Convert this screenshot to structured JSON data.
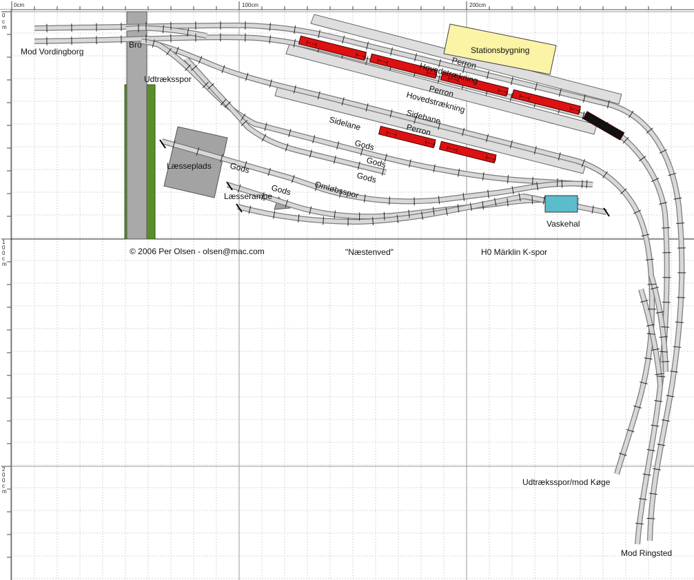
{
  "ruler": {
    "top": [
      "0cm",
      "100cm",
      "200cm"
    ],
    "left": [
      [
        "0",
        "c",
        "m"
      ],
      [
        "1",
        "0",
        "0",
        "c",
        "m"
      ],
      [
        "2",
        "0",
        "0",
        "c",
        "m"
      ]
    ]
  },
  "labels": {
    "mod_vordingborg": "Mod Vordingborg",
    "bro": "Bro",
    "udtraeksspor": "Udtræksspor",
    "laesseplads": "Læsseplads",
    "laesserampe": "Læsserampe",
    "stationsbygning": "Stationsbygning",
    "perron_1": "Perron",
    "perron_2": "Perron",
    "perron_3": "Perron",
    "hovedstraekning_1": "Hovedstrækning",
    "hovedstraekning_2": "Hovedstrækning",
    "sidebane": "Sidebane",
    "sidelane": "Sidelane",
    "gods_1": "Gods",
    "gods_2": "Gods",
    "gods_3": "Gods",
    "gods_4": "Gods",
    "gods_5": "Gods",
    "omloebsspor": "Omløbsspor",
    "vaskehal": "Vaskehal",
    "udtraeksspor_koege": "Udtræksspor/mod Køge",
    "mod_ringsted": "Mod Ringsted"
  },
  "footer": {
    "copyright": "© 2006 Per Olsen - olsen@mac.com",
    "layout_name": "\"Næstenved\"",
    "scale": "H0  Märklin K-spor"
  },
  "colors": {
    "grid": "#d6d6d6",
    "track_fill": "#d8d8d8",
    "track_edge": "#7a7a7a",
    "platform": "#dedede",
    "station": "#fbf3a6",
    "wagon": "#dd1111",
    "loco": "#111111",
    "bridge": "#a9a9a9",
    "green_strip": "#5a8e2a",
    "vaskehal": "#5bbccc",
    "loading": "#a3a3a3"
  }
}
